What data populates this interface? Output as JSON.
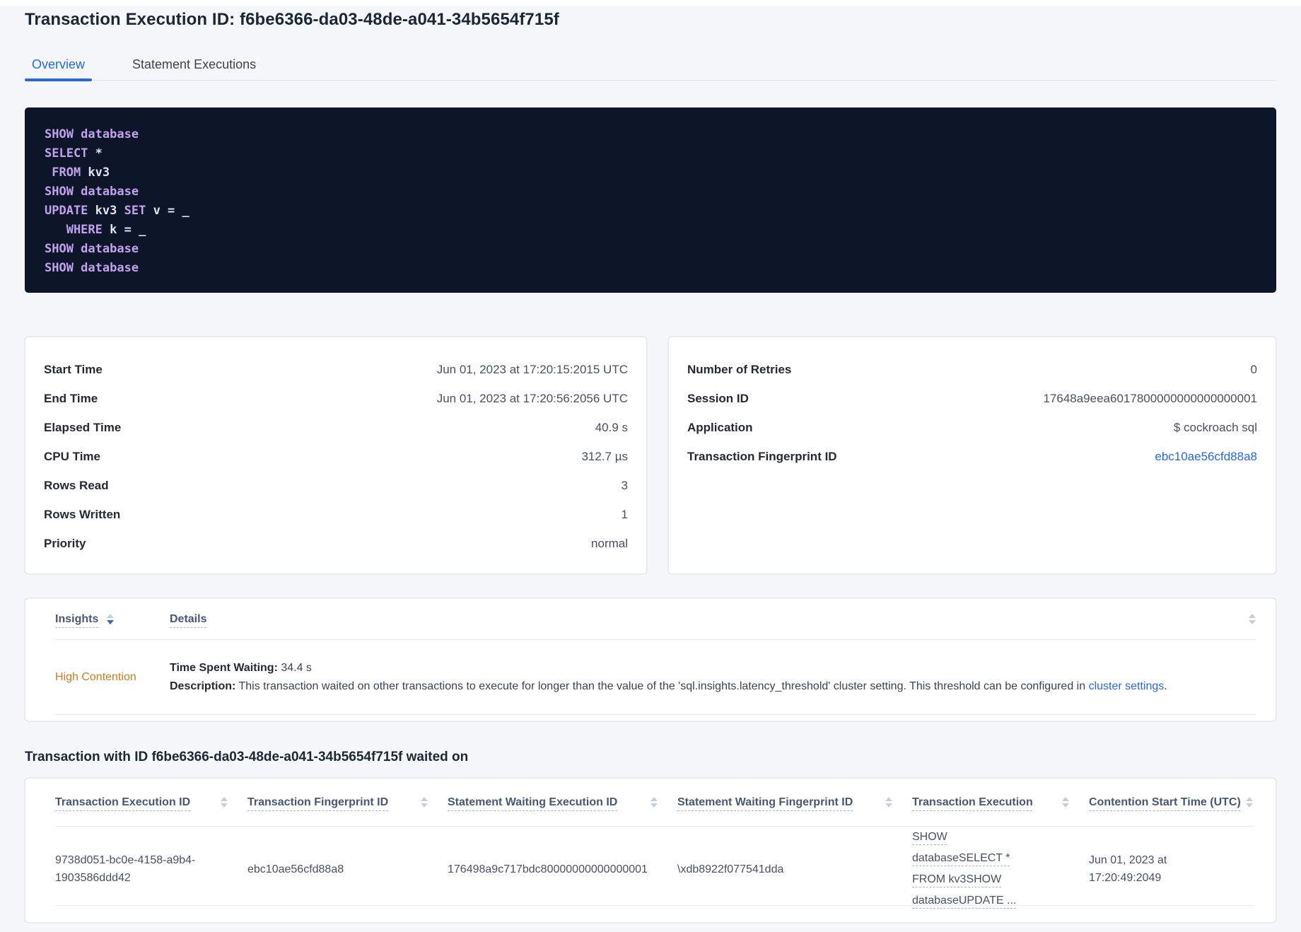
{
  "header": {
    "title": "Transaction Execution ID: f6be6366-da03-48de-a041-34b5654f715f",
    "tabs": [
      {
        "label": "Overview"
      },
      {
        "label": "Statement Executions"
      }
    ]
  },
  "sql_lines": [
    [
      {
        "t": "SHOW database"
      }
    ],
    [
      {
        "t": "SELECT"
      },
      {
        "t": " *"
      }
    ],
    [
      {
        "t": " FROM"
      },
      {
        "t": " kv3"
      }
    ],
    [
      {
        "t": "SHOW database"
      }
    ],
    [
      {
        "t": "UPDATE"
      },
      {
        "t": " kv3 "
      },
      {
        "t": "SET"
      },
      {
        "t": " v = _"
      }
    ],
    [
      {
        "t": "   WHERE"
      },
      {
        "t": " k = _"
      }
    ],
    [
      {
        "t": "SHOW database"
      }
    ],
    [
      {
        "t": "SHOW database"
      }
    ]
  ],
  "execution_details": {
    "rows": [
      {
        "label": "Start Time",
        "value": "Jun 01, 2023 at 17:20:15:2015 UTC"
      },
      {
        "label": "End Time",
        "value": "Jun 01, 2023 at 17:20:56:2056 UTC"
      },
      {
        "label": "Elapsed Time",
        "value": "40.9 s"
      },
      {
        "label": "CPU Time",
        "value": "312.7 µs"
      },
      {
        "label": "Rows Read",
        "value": "3"
      },
      {
        "label": "Rows Written",
        "value": "1"
      },
      {
        "label": "Priority",
        "value": "normal"
      }
    ]
  },
  "session_details": {
    "rows": [
      {
        "label": "Number of Retries",
        "value": "0"
      },
      {
        "label": "Session ID",
        "value": "17648a9eea6017800000000000000001"
      },
      {
        "label": "Application",
        "value": "$ cockroach sql"
      },
      {
        "label": "Transaction Fingerprint ID",
        "value": "ebc10ae56cfd88a8"
      }
    ]
  },
  "insights": {
    "col_insights": "Insights",
    "col_details": "Details",
    "row": {
      "insight_label": "High Contention",
      "waiting_label": "Time Spent Waiting:",
      "waiting_value": " 34.4 s",
      "description_label": "Description:",
      "description_text": " This transaction waited on other transactions to execute for longer than the value of the 'sql.insights.latency_threshold' cluster setting. This threshold can be configured in ",
      "description_link": "cluster settings",
      "description_suffix": "."
    }
  },
  "waited_on": {
    "heading": "Transaction with ID f6be6366-da03-48de-a041-34b5654f715f waited on",
    "columns": [
      "Transaction Execution ID",
      "Transaction Fingerprint ID",
      "Statement Waiting Execution ID",
      "Statement Waiting Fingerprint ID",
      "Transaction Execution",
      "Contention Start Time (UTC)"
    ],
    "row": {
      "transaction_execution_id": "9738d051-bc0e-4158-a9b4-1903586ddd42",
      "transaction_fingerprint_id": "ebc10ae56cfd88a8",
      "statement_waiting_execution_id": "176498a9c717bdc80000000000000001",
      "statement_waiting_fingerprint_id": "\\xdb8922f077541dda",
      "transaction_execution": "SHOW databaseSELECT * FROM kv3SHOW databaseUPDATE ...",
      "contention_start_time": "Jun 01, 2023 at 17:20:49:2049"
    }
  },
  "icons": {
    "sort": "sort-arrows-icon"
  },
  "colors": {
    "accent_blue": "#2667e6",
    "insight_orange": "#c77d1b",
    "code_background": "#0c1628",
    "code_keyword": "#c3a1ee",
    "code_identifier": "#dfe5f0",
    "page_background": "#f5f7fa"
  }
}
